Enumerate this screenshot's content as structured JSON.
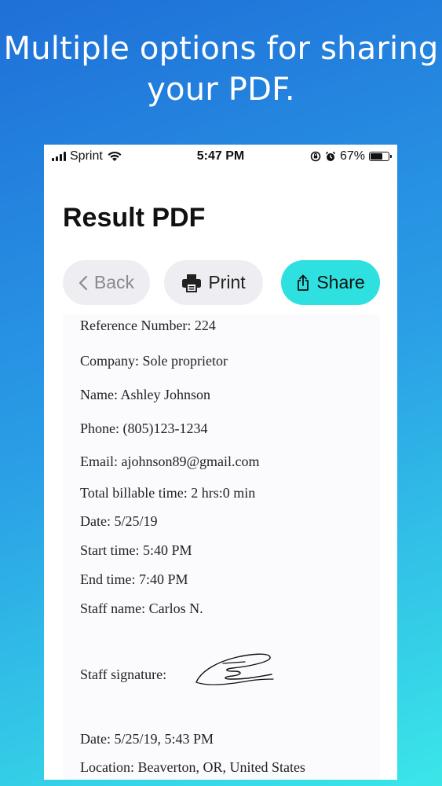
{
  "headline": {
    "line1": "Multiple options for sharing",
    "line2": "your PDF."
  },
  "status_bar": {
    "carrier": "Sprint",
    "time": "5:47 PM",
    "battery": "67%",
    "battery_level": 0.67
  },
  "page_title": "Result PDF",
  "buttons": {
    "back": "Back",
    "print": "Print",
    "share": "Share"
  },
  "pdf": {
    "reference": "Reference Number: 224",
    "company": "Company: Sole proprietor",
    "name": "Name: Ashley Johnson",
    "phone": "Phone: (805)123-1234",
    "email": "Email: ajohnson89@gmail.com",
    "billable": "Total billable time: 2 hrs:0 min",
    "date": "Date: 5/25/19",
    "start": "Start time: 5:40 PM",
    "end": "End time: 7:40 PM",
    "staff": "Staff name: Carlos N.",
    "signature_label": "Staff signature:",
    "signed_date": "Date: 5/25/19, 5:43 PM",
    "location": "Location: Beaverton, OR, United States"
  },
  "colors": {
    "share_accent": "#2ee0df",
    "bg_top": "#1f6fd8",
    "bg_bottom": "#3ae6e8"
  }
}
